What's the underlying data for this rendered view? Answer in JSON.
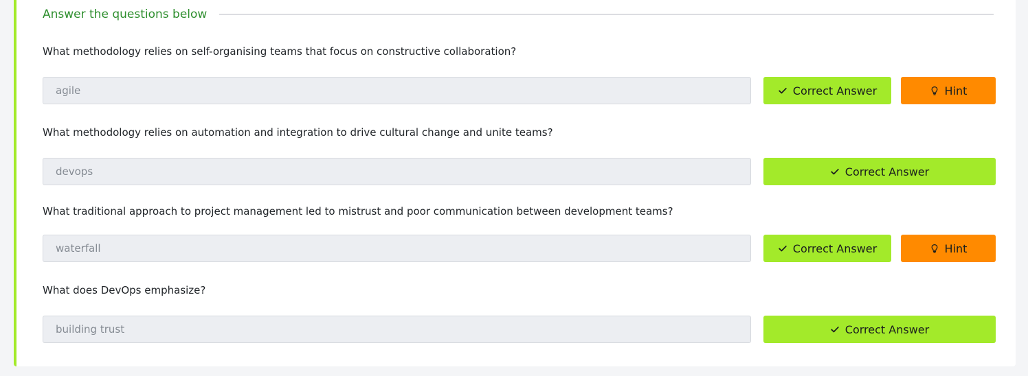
{
  "section": {
    "title": "Answer the questions below"
  },
  "questions": [
    {
      "text": "What methodology relies on self-organising teams that focus on constructive collaboration?",
      "answer": "agile",
      "correct_label": "Correct Answer",
      "hint_label": "Hint"
    },
    {
      "text": "What methodology relies on automation and integration to drive cultural change and unite teams?",
      "answer": "devops",
      "correct_label": "Correct Answer"
    },
    {
      "text": "What traditional approach to project management led to mistrust and poor communication between development teams?",
      "answer": "waterfall",
      "correct_label": "Correct Answer",
      "hint_label": "Hint"
    },
    {
      "text": "What does DevOps emphasize?",
      "answer": "building trust",
      "correct_label": "Correct Answer"
    }
  ],
  "icons": {
    "correct": "check-icon",
    "hint": "lightbulb-icon"
  },
  "colors": {
    "accent_green": "#a3ea2a",
    "hint_orange": "#ff8a00",
    "title_green": "#2f8f2f"
  }
}
